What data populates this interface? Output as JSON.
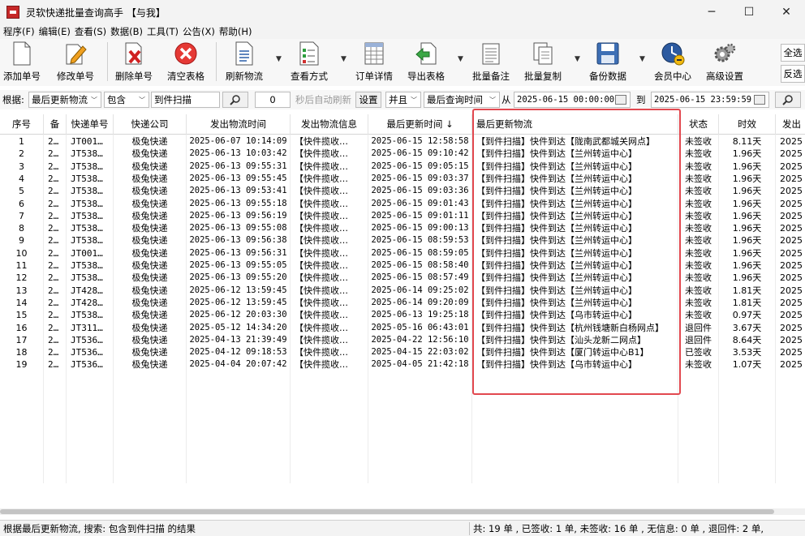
{
  "window": {
    "title": "灵软快递批量查询高手 【与我】",
    "minimize": "─",
    "maximize": "☐",
    "close": "✕"
  },
  "menu": [
    "程序(F)",
    "编辑(E)",
    "查看(S)",
    "数据(B)",
    "工具(T)",
    "公告(X)",
    "帮助(H)"
  ],
  "toolbar": {
    "add": "添加单号",
    "edit": "修改单号",
    "delete": "删除单号",
    "clear": "清空表格",
    "refresh": "刷新物流",
    "view": "查看方式",
    "detail": "订单详情",
    "export": "导出表格",
    "batch_note": "批量备注",
    "batch_copy": "批量复制",
    "backup": "备份数据",
    "member": "会员中心",
    "advanced": "高级设置",
    "select_all": "全选",
    "invert": "反选"
  },
  "filter": {
    "basis_label": "根据:",
    "field": "最后更新物流",
    "condition": "包含",
    "keyword": "到件扫描",
    "search_icon": "magnifier-icon",
    "interval": "0",
    "auto_refresh": "秒后自动刷新",
    "settings": "设置",
    "logic": "并且",
    "time_field": "最后查询时间",
    "from_label": "从",
    "from_time": "2025-06-15 00:00:00",
    "to_label": "到",
    "to_time": "2025-06-15 23:59:59"
  },
  "table": {
    "headers": [
      "序号",
      "备",
      "快递单号",
      "快递公司",
      "发出物流时间",
      "发出物流信息",
      "最后更新时间 ↓",
      "最后更新物流",
      "状态",
      "时效",
      "发出"
    ],
    "rows": [
      [
        "1",
        "2…",
        "JT001…",
        "极兔快递",
        "2025-06-07 10:14:09",
        "【快件揽收…",
        "2025-06-15 12:58:58",
        "【到件扫描】快件到达【陇南武都城关网点】",
        "未签收",
        "8.11天",
        "2025"
      ],
      [
        "2",
        "2…",
        "JT538…",
        "极兔快递",
        "2025-06-13 10:03:42",
        "【快件揽收…",
        "2025-06-15 09:10:42",
        "【到件扫描】快件到达【兰州转运中心】",
        "未签收",
        "1.96天",
        "2025"
      ],
      [
        "3",
        "2…",
        "JT538…",
        "极兔快递",
        "2025-06-13 09:55:31",
        "【快件揽收…",
        "2025-06-15 09:05:15",
        "【到件扫描】快件到达【兰州转运中心】",
        "未签收",
        "1.96天",
        "2025"
      ],
      [
        "4",
        "2…",
        "JT538…",
        "极兔快递",
        "2025-06-13 09:55:45",
        "【快件揽收…",
        "2025-06-15 09:03:37",
        "【到件扫描】快件到达【兰州转运中心】",
        "未签收",
        "1.96天",
        "2025"
      ],
      [
        "5",
        "2…",
        "JT538…",
        "极兔快递",
        "2025-06-13 09:53:41",
        "【快件揽收…",
        "2025-06-15 09:03:36",
        "【到件扫描】快件到达【兰州转运中心】",
        "未签收",
        "1.96天",
        "2025"
      ],
      [
        "6",
        "2…",
        "JT538…",
        "极兔快递",
        "2025-06-13 09:55:18",
        "【快件揽收…",
        "2025-06-15 09:01:43",
        "【到件扫描】快件到达【兰州转运中心】",
        "未签收",
        "1.96天",
        "2025"
      ],
      [
        "7",
        "2…",
        "JT538…",
        "极兔快递",
        "2025-06-13 09:56:19",
        "【快件揽收…",
        "2025-06-15 09:01:11",
        "【到件扫描】快件到达【兰州转运中心】",
        "未签收",
        "1.96天",
        "2025"
      ],
      [
        "8",
        "2…",
        "JT538…",
        "极兔快递",
        "2025-06-13 09:55:08",
        "【快件揽收…",
        "2025-06-15 09:00:13",
        "【到件扫描】快件到达【兰州转运中心】",
        "未签收",
        "1.96天",
        "2025"
      ],
      [
        "9",
        "2…",
        "JT538…",
        "极兔快递",
        "2025-06-13 09:56:38",
        "【快件揽收…",
        "2025-06-15 08:59:53",
        "【到件扫描】快件到达【兰州转运中心】",
        "未签收",
        "1.96天",
        "2025"
      ],
      [
        "10",
        "2…",
        "JT001…",
        "极兔快递",
        "2025-06-13 09:56:31",
        "【快件揽收…",
        "2025-06-15 08:59:05",
        "【到件扫描】快件到达【兰州转运中心】",
        "未签收",
        "1.96天",
        "2025"
      ],
      [
        "11",
        "2…",
        "JT538…",
        "极兔快递",
        "2025-06-13 09:55:05",
        "【快件揽收…",
        "2025-06-15 08:58:40",
        "【到件扫描】快件到达【兰州转运中心】",
        "未签收",
        "1.96天",
        "2025"
      ],
      [
        "12",
        "2…",
        "JT538…",
        "极兔快递",
        "2025-06-13 09:55:20",
        "【快件揽收…",
        "2025-06-15 08:57:49",
        "【到件扫描】快件到达【兰州转运中心】",
        "未签收",
        "1.96天",
        "2025"
      ],
      [
        "13",
        "2…",
        "JT428…",
        "极兔快递",
        "2025-06-12 13:59:45",
        "【快件揽收…",
        "2025-06-14 09:25:02",
        "【到件扫描】快件到达【兰州转运中心】",
        "未签收",
        "1.81天",
        "2025"
      ],
      [
        "14",
        "2…",
        "JT428…",
        "极兔快递",
        "2025-06-12 13:59:45",
        "【快件揽收…",
        "2025-06-14 09:20:09",
        "【到件扫描】快件到达【兰州转运中心】",
        "未签收",
        "1.81天",
        "2025"
      ],
      [
        "15",
        "2…",
        "JT538…",
        "极兔快递",
        "2025-06-12 20:03:30",
        "【快件揽收…",
        "2025-06-13 19:25:18",
        "【到件扫描】快件到达【乌市转运中心】",
        "未签收",
        "0.97天",
        "2025"
      ],
      [
        "16",
        "2…",
        "JT311…",
        "极兔快递",
        "2025-05-12 14:34:20",
        "【快件揽收…",
        "2025-05-16 06:43:01",
        "【到件扫描】快件到达【杭州钱塘新白杨网点】",
        "退回件",
        "3.67天",
        "2025"
      ],
      [
        "17",
        "2…",
        "JT536…",
        "极兔快递",
        "2025-04-13 21:39:49",
        "【快件揽收…",
        "2025-04-22 12:56:10",
        "【到件扫描】快件到达【汕头龙新二网点】",
        "退回件",
        "8.64天",
        "2025"
      ],
      [
        "18",
        "2…",
        "JT536…",
        "极兔快递",
        "2025-04-12 09:18:53",
        "【快件揽收…",
        "2025-04-15 22:03:02",
        "【到件扫描】快件到达【厦门转运中心B1】",
        "已签收",
        "3.53天",
        "2025"
      ],
      [
        "19",
        "2…",
        "JT536…",
        "极兔快递",
        "2025-04-04 20:07:42",
        "【快件揽收…",
        "2025-04-05 21:42:18",
        "【到件扫描】快件到达【乌市转运中心】",
        "未签收",
        "1.07天",
        "2025"
      ]
    ]
  },
  "status": {
    "left": "根据最后更新物流, 搜索: 包含到件扫描 的结果",
    "right": "共: 19 单 , 已签收: 1 单, 未签收: 16 单 , 无信息: 0 单 , 退回件: 2 单,"
  },
  "colors": {
    "highlight": "#e2484f",
    "toolbar_bg": "#f7f7f7"
  }
}
